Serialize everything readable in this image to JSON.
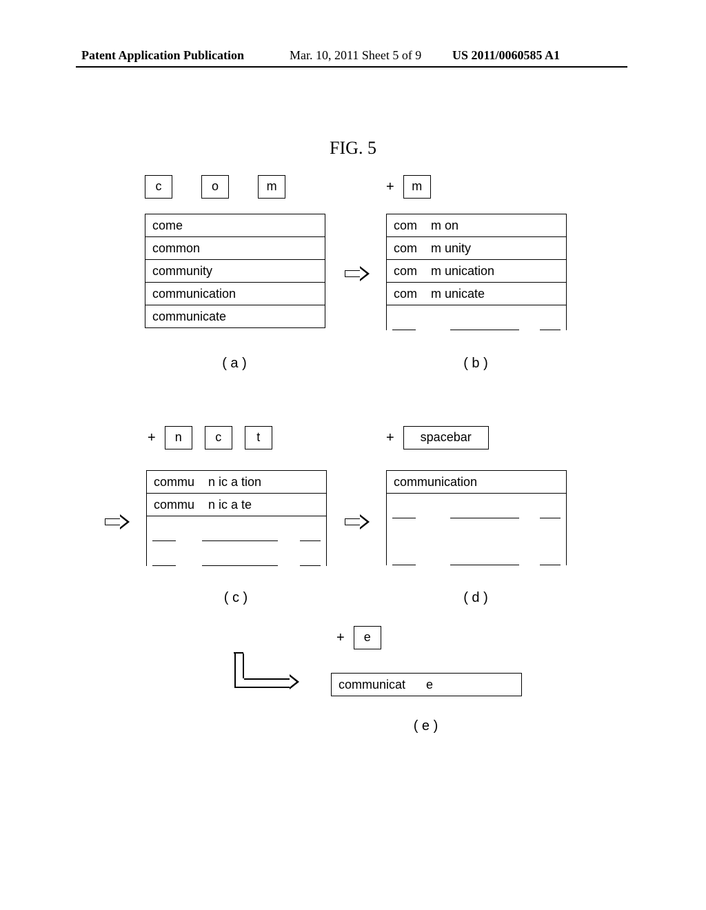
{
  "header": {
    "left": "Patent Application Publication",
    "mid": "Mar. 10, 2011  Sheet 5 of 9",
    "right": "US 2011/0060585 A1"
  },
  "figure_title": "FIG. 5",
  "panel_a": {
    "keys": [
      "c",
      "o",
      "m"
    ],
    "list": [
      "come",
      "common",
      "community",
      "communication",
      "communicate"
    ],
    "label": "( a )"
  },
  "panel_b": {
    "plus": "+",
    "keys": [
      "m"
    ],
    "list": [
      "com    m on",
      "com    m unity",
      "com    m unication",
      "com    m unicate"
    ],
    "label": "( b )"
  },
  "panel_c": {
    "plus": "+",
    "keys": [
      "n",
      "c",
      "t"
    ],
    "list": [
      "commu    n ic a tion",
      "commu    n ic a te"
    ],
    "label": "( c )"
  },
  "panel_d": {
    "plus": "+",
    "keys": [
      "spacebar"
    ],
    "list": [
      "communication"
    ],
    "label": "( d )"
  },
  "panel_e": {
    "plus": "+",
    "keys": [
      "e"
    ],
    "result": "communicat      e",
    "label": "( e )"
  }
}
